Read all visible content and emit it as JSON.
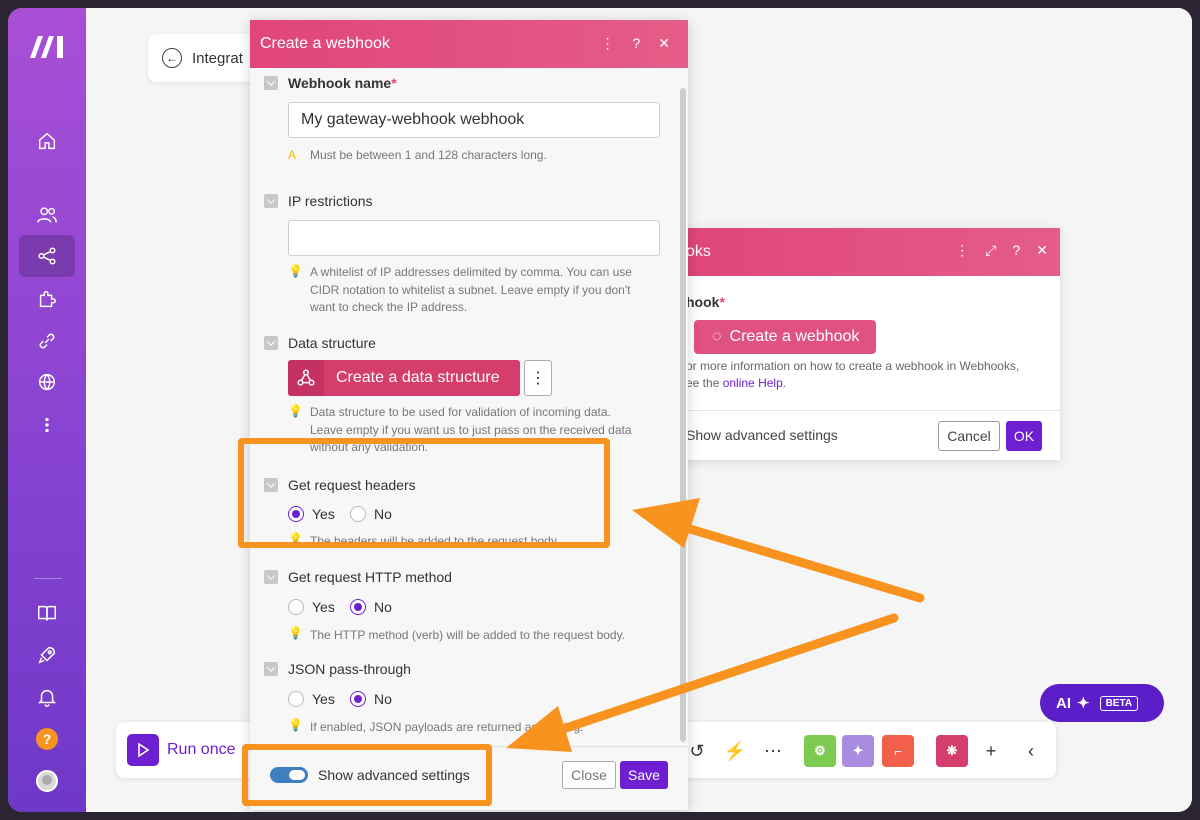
{
  "breadcrumb": {
    "label": "Integrat"
  },
  "toolbar": {
    "run_label": "Run once",
    "module_icons": [
      "undo-icon",
      "magic-wand-icon",
      "more-icon"
    ],
    "square_colors": [
      "#7dcb50",
      "#a98be0",
      "#f2604c",
      "#d43d6c"
    ]
  },
  "ai": {
    "label": "AI",
    "beta": "BETA"
  },
  "webhooks_dialog": {
    "title": "oks",
    "field_label": "hook",
    "required": "*",
    "create_button": "Create a webhook",
    "info_line1": "or more information on how to create a webhook in Webhooks,",
    "info_line2_prefix": "ee the ",
    "info_link": "online Help",
    "info_line2_suffix": ".",
    "show_advanced": "Show advanced settings",
    "cancel": "Cancel",
    "ok": "OK"
  },
  "dialog": {
    "title": "Create a webhook",
    "webhook_name": {
      "label": "Webhook name",
      "required": "*",
      "value": "My gateway-webhook webhook",
      "hint_icon": "A",
      "hint": "Must be between 1 and 128 characters long."
    },
    "ip_restrictions": {
      "label": "IP restrictions",
      "value": "",
      "hint_line1": "A whitelist of IP addresses delimited by comma. You can use",
      "hint_line2": "CIDR notation to whitelist a subnet. Leave empty if you don't",
      "hint_line3": "want to check the IP address."
    },
    "data_structure": {
      "label": "Data structure",
      "button": "Create a data structure",
      "more": "⋮",
      "hint_line1": "Data structure to be used for validation of incoming data.",
      "hint_line2": "Leave empty if you want us to just pass on the received data",
      "hint_line3": "without any validation."
    },
    "get_request_headers": {
      "label": "Get request headers",
      "yes": "Yes",
      "no": "No",
      "selected": "Yes",
      "hint": "The headers will be added to the request body."
    },
    "get_request_method": {
      "label": "Get request HTTP method",
      "yes": "Yes",
      "no": "No",
      "selected": "No",
      "hint": "The HTTP method (verb) will be added to the request body."
    },
    "json_passthrough": {
      "label": "JSON pass-through",
      "yes": "Yes",
      "no": "No",
      "selected": "No",
      "hint": "If enabled, JSON payloads are returned as a string."
    },
    "footer": {
      "show_advanced": "Show advanced settings",
      "close": "Close",
      "save": "Save"
    }
  },
  "colors": {
    "accent": "#6d1fd1",
    "header": "#e0457b",
    "highlight": "#f7931e"
  }
}
